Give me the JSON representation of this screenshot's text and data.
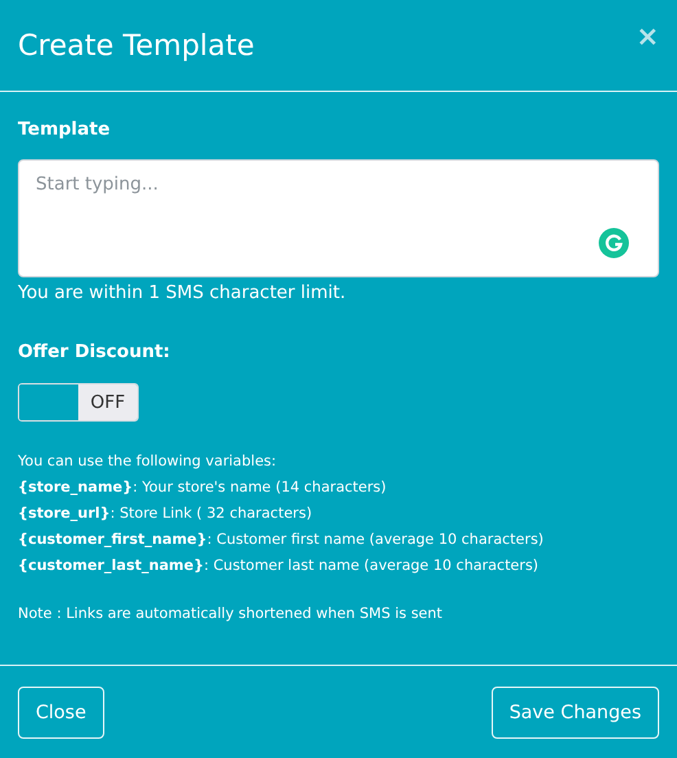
{
  "dialog": {
    "title": "Create Template",
    "close_glyph": "×"
  },
  "template": {
    "label": "Template",
    "placeholder": "Start typing...",
    "hint": "You are within 1 SMS character limit."
  },
  "discount": {
    "label": "Offer Discount:",
    "toggle": {
      "label": "OFF",
      "on": false
    }
  },
  "variables": {
    "intro": "You can use the following variables:",
    "items": [
      "**{store_name}**: Your store's name (14 characters)",
      "**{store_url}**: Store Link ( 32 characters)",
      "**{customer_first_name}**: Customer first name (average 10 characters)",
      "**{customer_last_name}**: Customer last name (average 10 characters)"
    ]
  },
  "note": "Note : Links are automatically shortened when SMS is sent",
  "buttons": [
    "Close",
    "Save Changes"
  ]
}
